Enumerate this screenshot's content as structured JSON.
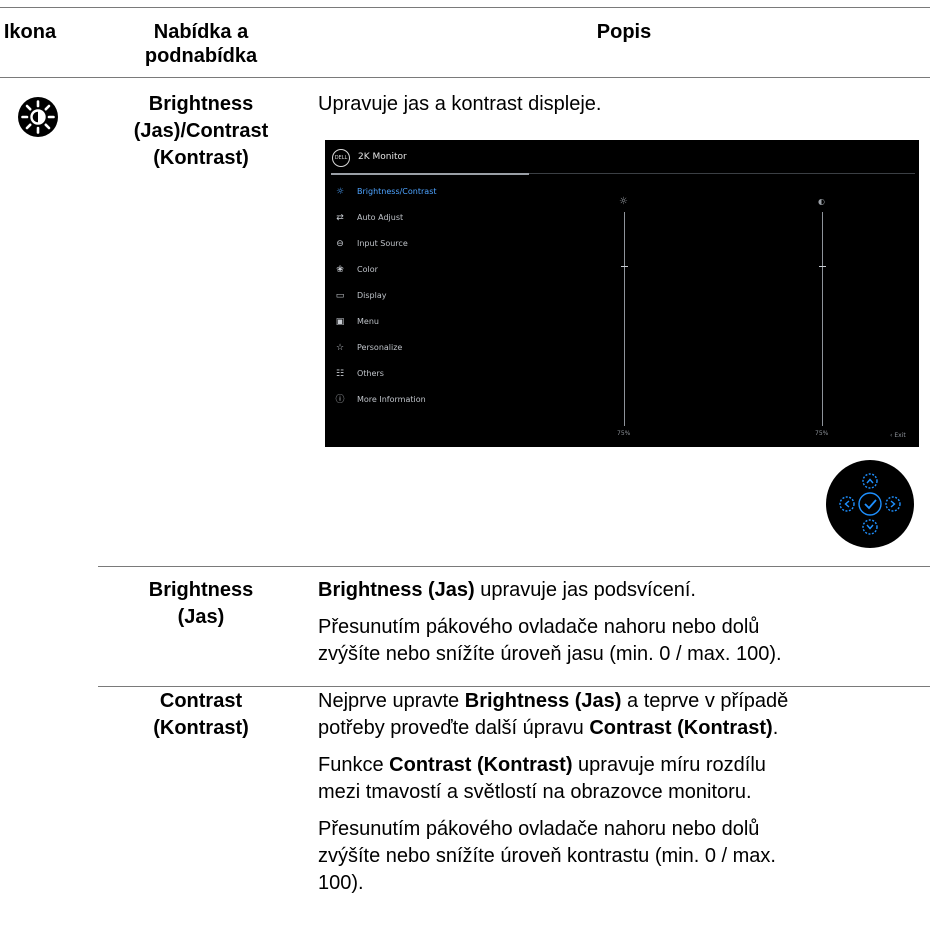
{
  "header": {
    "col_icon": "Ikona",
    "col_menu_line1": "Nabídka a",
    "col_menu_line2": "podnabídka",
    "col_desc": "Popis"
  },
  "main_row": {
    "menu_line1": "Brightness",
    "menu_line2": "(Jas)/Contrast",
    "menu_line3": "(Kontrast)",
    "description": "Upravuje jas a kontrast displeje.",
    "icon": "brightness-icon"
  },
  "osd": {
    "logo": "DELL",
    "title": "2K Monitor",
    "menu_items": [
      {
        "icon": "sun-icon",
        "label": "Brightness/Contrast",
        "active": true
      },
      {
        "icon": "auto-adjust-icon",
        "label": "Auto Adjust",
        "active": false
      },
      {
        "icon": "input-source-icon",
        "label": "Input Source",
        "active": false
      },
      {
        "icon": "color-icon",
        "label": "Color",
        "active": false
      },
      {
        "icon": "display-icon",
        "label": "Display",
        "active": false
      },
      {
        "icon": "menu-icon",
        "label": "Menu",
        "active": false
      },
      {
        "icon": "star-icon",
        "label": "Personalize",
        "active": false
      },
      {
        "icon": "others-icon",
        "label": "Others",
        "active": false
      },
      {
        "icon": "info-icon",
        "label": "More Information",
        "active": false
      }
    ],
    "brightness_value": "75%",
    "contrast_value": "75%",
    "exit_label": "Exit",
    "brightness_level": 0.75,
    "contrast_level": 0.75
  },
  "joystick": {
    "icon": "joystick-icon",
    "accent": "#1e90ff"
  },
  "sub_rows": [
    {
      "name_line1": "Brightness",
      "name_line2": "(Jas)",
      "p1_bold": "Brightness (Jas)",
      "p1_text": " upravuje jas podsvícení.",
      "p2_line1": "Přesunutím pákového ovladače nahoru nebo dolů",
      "p2_line2": "zvýšíte nebo snížíte úroveň jasu (min. 0 / max. 100)."
    },
    {
      "name_line1": "Contrast",
      "name_line2": "(Kontrast)",
      "p1_a": "Nejprve upravte ",
      "p1_bold1": "Brightness (Jas)",
      "p1_b": " a teprve v případě",
      "p1_c": "potřeby proveďte další úpravu ",
      "p1_bold2": "Contrast (Kontrast)",
      "p1_d": ".",
      "p2_a": "Funkce ",
      "p2_bold": "Contrast (Kontrast)",
      "p2_b": " upravuje míru rozdílu",
      "p2_line2": "mezi tmavostí a světlostí na obrazovce monitoru.",
      "p3_line1": "Přesunutím pákového ovladače nahoru nebo dolů",
      "p3_line2": "zvýšíte nebo snížíte úroveň kontrastu (min. 0 / max.",
      "p3_line3": "100)."
    }
  ],
  "colors": {
    "rule": "#7a7a7a",
    "osd_bg": "#000000",
    "osd_active": "#4da3ff"
  }
}
